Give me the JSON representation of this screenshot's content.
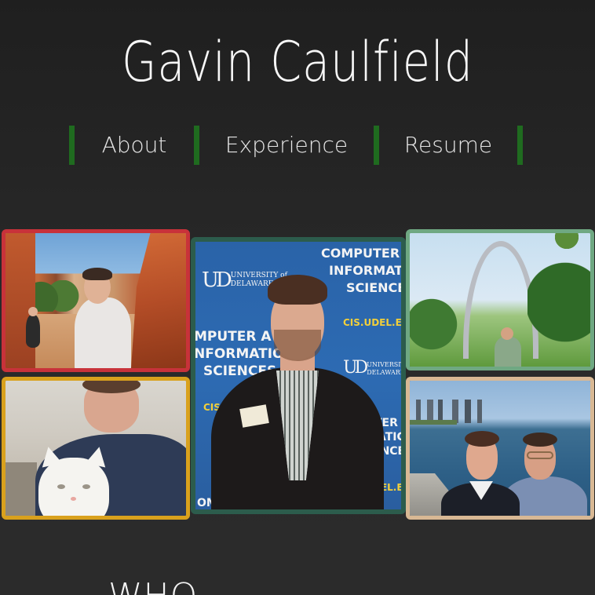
{
  "header": {
    "title": "Gavin Caulfield"
  },
  "nav": {
    "items": [
      {
        "label": "About"
      },
      {
        "label": "Experience"
      },
      {
        "label": "Resume"
      }
    ],
    "divider_color": "#1f6b1f"
  },
  "photos": [
    {
      "subject": "hiking-canyon",
      "border_color": "#c8323a"
    },
    {
      "subject": "with-white-cat",
      "border_color": "#d9a11d"
    },
    {
      "subject": "university-banner-portrait",
      "border_color": "#2c5c4c",
      "banner": {
        "line1": "COMPUTER",
        "line2": "INFORMATI",
        "line3": "SCIENCE",
        "url": "CIS.UDEL.ED",
        "mid1": "MPUTER A",
        "mid2": "NFORMATIO",
        "mid3": "SCIENCES",
        "cis_left": "CIS.",
        "low1": "TER A",
        "low2": "ATIC",
        "low3": "ENCES",
        "url_low": "DEL.ED",
        "bottom": "OMP",
        "logo_letters": "UD",
        "logo_univ": "UNIVERSITY of",
        "logo_name": "DELAWARE."
      }
    },
    {
      "subject": "gateway-arch",
      "border_color": "#6fa882"
    },
    {
      "subject": "lakefront-selfie",
      "border_color": "#d8b894"
    }
  ],
  "section": {
    "heading": "WHO"
  }
}
